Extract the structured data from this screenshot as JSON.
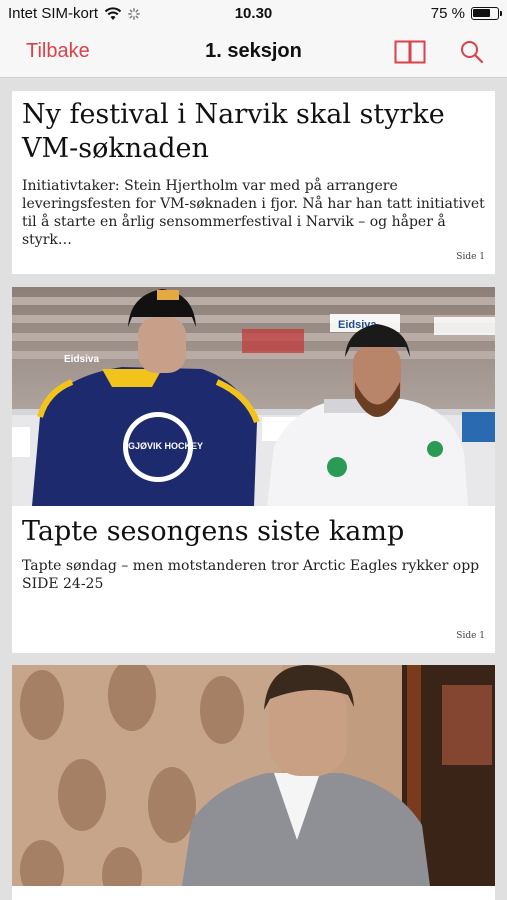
{
  "status": {
    "carrier": "Intet SIM-kort",
    "time": "10.30",
    "battery": "75 %",
    "battery_level": 0.75
  },
  "nav": {
    "back_label": "Tilbake",
    "title": "1. seksjon"
  },
  "articles": [
    {
      "title": "Ny festival i Narvik skal styrke VM-søknaden",
      "lead": "Initiativtaker: Stein Hjertholm var med på arrangere leveringsfesten for VM-søknaden i fjor. Nå har han tatt initiativet til å starte en årlig sensommerfestival i Narvik – og håper å styrk…",
      "page": "Side 1"
    },
    {
      "title": "Tapte sesongens siste kamp",
      "lead": "Tapte søndag – men motstanderen tror Arctic Eagles rykker opp SIDE 24-25",
      "page": "Side 1",
      "photo": {
        "jersey_left_text": "GJØVIK HOCKEY",
        "sponsor_left": "Eidsiva",
        "sponsor_right": "Eidsiva"
      }
    },
    {
      "title": "",
      "photo": {}
    }
  ],
  "colors": {
    "accent": "#d9424b",
    "bar_bg": "#f7f7f7",
    "feed_bg": "#e0e0e0"
  }
}
